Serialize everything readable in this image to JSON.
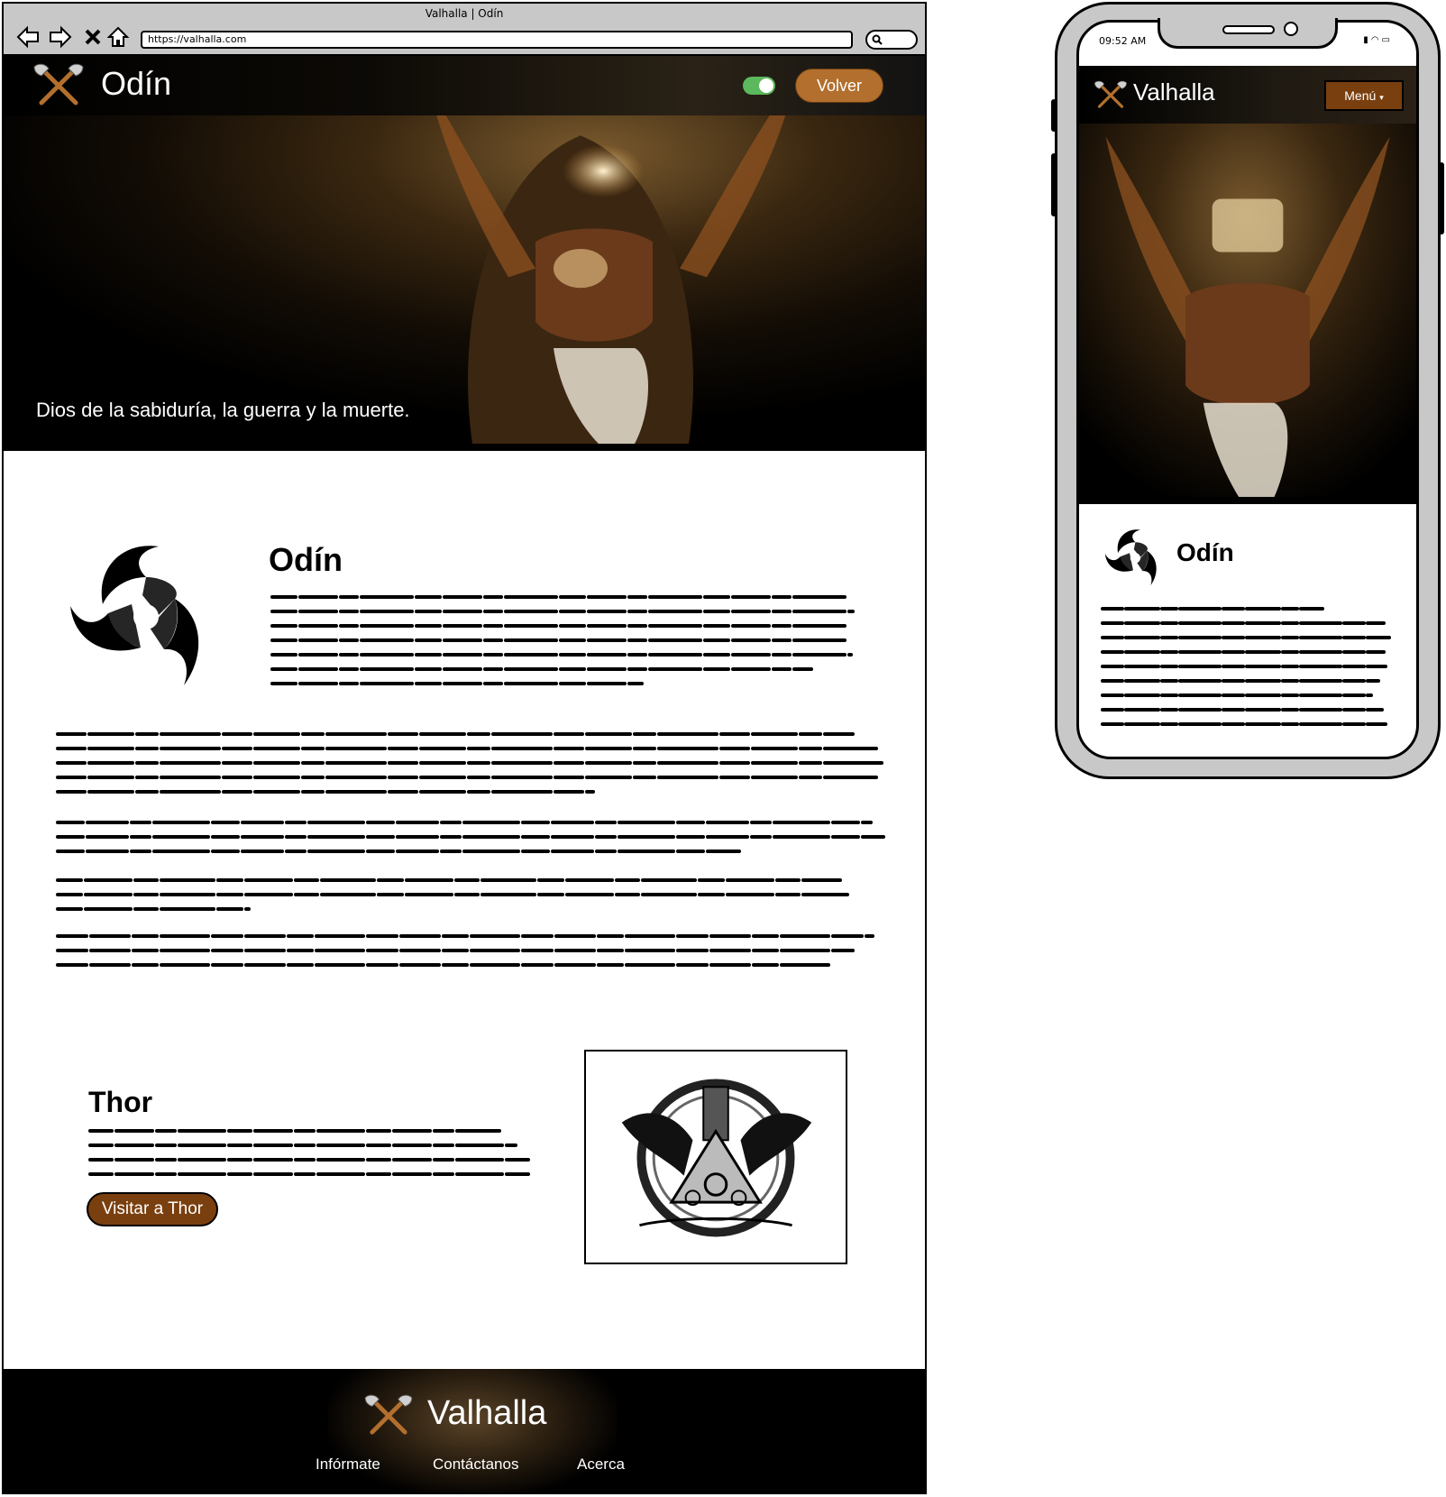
{
  "browser": {
    "window_title": "Valhalla | Odín",
    "url": "https://valhalla.com",
    "icons": [
      "back-arrow-icon",
      "forward-arrow-icon",
      "close-icon",
      "home-icon",
      "search-icon"
    ]
  },
  "hero": {
    "title": "Odín",
    "button_label": "Volver",
    "tagline": "Dios de la sabiduría, la guerra y la muerte.",
    "toggle_state": "on"
  },
  "odin_section": {
    "heading": "Odín"
  },
  "thor_section": {
    "heading": "Thor",
    "button_label": "Visitar a Thor"
  },
  "footer": {
    "brand": "Valhalla",
    "links": [
      "Infórmate",
      "Contáctanos",
      "Acerca"
    ]
  },
  "phone": {
    "status_time": "09:52 AM",
    "brand": "Valhalla",
    "menu_label": "Menú",
    "menu_caret": "▾",
    "heading": "Odín"
  },
  "colors": {
    "accent_orange": "#b26f2d",
    "accent_brown": "#7a3f0f",
    "toggle_green": "#5cb85c"
  }
}
